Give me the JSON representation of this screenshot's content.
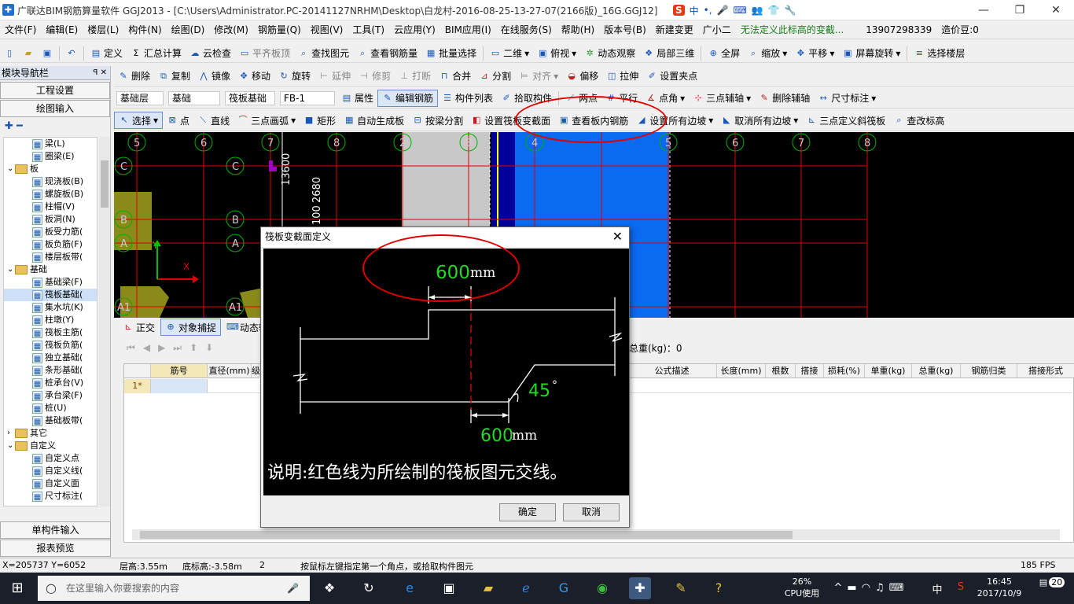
{
  "window": {
    "title": "广联达BIM钢筋算量软件 GGJ2013 - [C:\\Users\\Administrator.PC-20141127NRHM\\Desktop\\白龙村-2016-08-25-13-27-07(2166版)_16G.GGJ12]",
    "ime": [
      "中",
      "•,",
      "🎤",
      "⌨",
      "👥",
      "👕",
      "🔧"
    ]
  },
  "menu": {
    "items": [
      "文件(F)",
      "编辑(E)",
      "楼层(L)",
      "构件(N)",
      "绘图(D)",
      "修改(M)",
      "钢筋量(Q)",
      "视图(V)",
      "工具(T)",
      "云应用(Y)",
      "BIM应用(I)",
      "在线服务(S)",
      "帮助(H)",
      "版本号(B)",
      "新建变更",
      "广小二"
    ],
    "notice": "无法定义此标高的变截...",
    "phone": "13907298339",
    "price": "造价豆:0"
  },
  "toolbar1": [
    "定义",
    "汇总计算",
    "云检查",
    "平齐板顶",
    "查找图元",
    "查看钢筋量",
    "批量选择",
    "二维",
    "俯视",
    "动态观察",
    "局部三维",
    "全屏",
    "缩放",
    "平移",
    "屏幕旋转",
    "选择楼层"
  ],
  "toolbar2": [
    "删除",
    "复制",
    "镜像",
    "移动",
    "旋转",
    "延伸",
    "修剪",
    "打断",
    "合并",
    "分割",
    "对齐",
    "偏移",
    "拉伸",
    "设置夹点"
  ],
  "toolbar3": {
    "floor": "基础层",
    "category": "基础",
    "type": "筏板基础",
    "item": "FB-1",
    "buttons": [
      "属性",
      "编辑钢筋",
      "构件列表",
      "拾取构件",
      "两点",
      "平行",
      "点角",
      "三点辅轴",
      "删除辅轴",
      "尺寸标注"
    ]
  },
  "toolbar4": [
    "选择",
    "点",
    "直线",
    "三点画弧",
    "矩形",
    "自动生成板",
    "按梁分割",
    "设置筏板变截面",
    "查看板内钢筋",
    "设置所有边坡",
    "取消所有边坡",
    "三点定义斜筏板",
    "查改标高"
  ],
  "nav": {
    "title": "模块导航栏",
    "pin": "ꟼ  ✕",
    "btn_setup": "工程设置",
    "btn_draw": "绘图输入",
    "btn_single": "单构件输入",
    "btn_report": "报表预览",
    "tree": [
      {
        "label": "梁(L)",
        "level": 2
      },
      {
        "label": "圈梁(E)",
        "level": 2
      },
      {
        "label": "板",
        "level": 1,
        "folder": true
      },
      {
        "label": "现浇板(B)",
        "level": 2
      },
      {
        "label": "螺旋板(B)",
        "level": 2
      },
      {
        "label": "柱帽(V)",
        "level": 2
      },
      {
        "label": "板洞(N)",
        "level": 2
      },
      {
        "label": "板受力筋(",
        "level": 2
      },
      {
        "label": "板负筋(F)",
        "level": 2
      },
      {
        "label": "楼层板带(",
        "level": 2
      },
      {
        "label": "基础",
        "level": 1,
        "folder": true
      },
      {
        "label": "基础梁(F)",
        "level": 2
      },
      {
        "label": "筏板基础(",
        "level": 2
      },
      {
        "label": "集水坑(K)",
        "level": 2
      },
      {
        "label": "柱墩(Y)",
        "level": 2
      },
      {
        "label": "筏板主筋(",
        "level": 2
      },
      {
        "label": "筏板负筋(",
        "level": 2
      },
      {
        "label": "独立基础(",
        "level": 2
      },
      {
        "label": "条形基础(",
        "level": 2
      },
      {
        "label": "桩承台(V)",
        "level": 2
      },
      {
        "label": "承台梁(F)",
        "level": 2
      },
      {
        "label": "桩(U)",
        "level": 2
      },
      {
        "label": "基础板带(",
        "level": 2
      },
      {
        "label": "其它",
        "level": 1,
        "folder": true
      },
      {
        "label": "自定义",
        "level": 1,
        "folder": true
      },
      {
        "label": "自定义点",
        "level": 2
      },
      {
        "label": "自定义线(",
        "level": 2
      },
      {
        "label": "自定义面",
        "level": 2
      },
      {
        "label": "尺寸标注(",
        "level": 2
      }
    ]
  },
  "canvas": {
    "axis_top": [
      "5",
      "6",
      "7",
      "8",
      "2",
      "3",
      "4",
      "5",
      "6",
      "7",
      "8"
    ],
    "axis_left": [
      "C",
      "B",
      "A",
      "A1"
    ],
    "dims": [
      "13600",
      "2680",
      "100"
    ]
  },
  "lower": {
    "snap": [
      "正交",
      "对象捕捉",
      "动态输"
    ],
    "total_weight": "总重(kg)：0",
    "columns": [
      "筋号",
      "直径(mm)",
      "级",
      "公式描述",
      "长度(mm)",
      "根数",
      "搭接",
      "损耗(%)",
      "单重(kg)",
      "总重(kg)",
      "钢筋归类",
      "搭接形式"
    ],
    "row_num": "1*"
  },
  "dialog": {
    "title": "筏板变截面定义",
    "width_top": "600",
    "width_bottom": "600",
    "unit": "mm",
    "angle": "45",
    "angle_unit": "°",
    "note": "说明:红色线为所绘制的筏板图元交线。",
    "ok": "确定",
    "cancel": "取消"
  },
  "status": {
    "coords": "X=205737 Y=6052",
    "floor_height": "层高:3.55m",
    "base_height": "底标高:-3.58m",
    "num": "2",
    "hint": "按鼠标左键指定第一个角点，或拾取构件图元",
    "fps": "185 FPS"
  },
  "taskbar": {
    "search_placeholder": "在这里输入你要搜索的内容",
    "cpu": "26%",
    "cpu_label": "CPU使用",
    "ime": "中",
    "time": "16:45",
    "date": "2017/10/9",
    "notify": "20"
  }
}
